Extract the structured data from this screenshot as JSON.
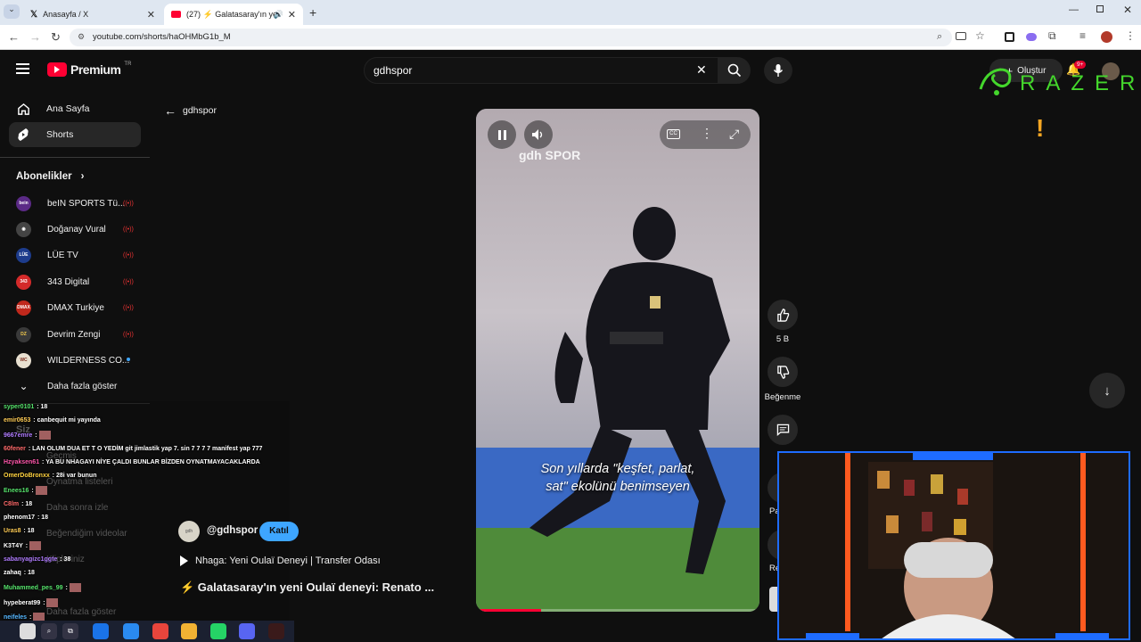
{
  "browser": {
    "tabs": [
      {
        "title": "Anasayfa / X",
        "icon": "x-logo-icon"
      },
      {
        "title": "(27) ⚡ Galatasaray'ın yeni",
        "icon": "youtube-icon",
        "active": true
      }
    ],
    "url": "youtube.com/shorts/haOHMbG1b_M"
  },
  "header": {
    "logo": "Premium",
    "region": "TR",
    "search_value": "gdhspor",
    "create_label": "Oluştur",
    "notifications_badge": "9+"
  },
  "sidebar": {
    "items": [
      {
        "label": "Ana Sayfa",
        "icon": "home-icon"
      },
      {
        "label": "Shorts",
        "icon": "shorts-icon"
      }
    ],
    "subscriptions_label": "Abonelikler",
    "subscriptions": [
      {
        "name": "beIN SPORTS Tü...",
        "avatar_color": "#5b2a86"
      },
      {
        "name": "Doğanay Vural",
        "avatar_color": "#444444"
      },
      {
        "name": "LÜE TV",
        "avatar_color": "#1d3c8c"
      },
      {
        "name": "343 Digital",
        "avatar_color": "#d42a2a"
      },
      {
        "name": "DMAX Turkiye",
        "avatar_color": "#c0281c"
      },
      {
        "name": "Devrim Zengi",
        "avatar_color": "#3a3a3a"
      },
      {
        "name": "WILDERNESS CO...",
        "avatar_color": "#e8e0d0"
      }
    ],
    "show_more_label": "Daha fazla göster",
    "you_items": [
      "Siz",
      "Geçmiş",
      "Oynatma listeleri",
      "Daha sonra izle",
      "Beğendiğim videolar",
      "Klipleriniz",
      "Daha fazla göster"
    ]
  },
  "back": {
    "label": "gdhspor"
  },
  "chat": [
    {
      "user": "syper0101",
      "msg": "18",
      "color": "#55e36b"
    },
    {
      "user": "emir0653",
      "msg": "canbequit mi yayında",
      "color": "#ffcc55"
    },
    {
      "user": "9667emre",
      "msg": "",
      "color": "#b07cff"
    },
    {
      "user": "60fener",
      "msg": "LAN OLUM DUA ET T O YEDİM git jimlastik yap 7. sin 7 7 7 7 manifest yap 777",
      "color": "#ff6a6a"
    },
    {
      "user": "Hzyaksen61",
      "msg": "YA BU NHAGAYI NİYE ÇALDI BUNLAR BİZDEN OYNATMAYACAKLARDA",
      "color": "#ff55aa"
    },
    {
      "user": "OmerDoBronxx",
      "msg": "28i var bunun",
      "color": "#ffd23f"
    },
    {
      "user": "Enees16",
      "msg": "",
      "color": "#55e36b"
    },
    {
      "user": "C8lm",
      "msg": "18",
      "color": "#ff6a6a"
    },
    {
      "user": "phenom17",
      "msg": "18",
      "color": "#ffffff"
    },
    {
      "user": "Uras8",
      "msg": "18",
      "color": "#ffcc55"
    },
    {
      "user": "K3T4Y",
      "msg": "",
      "color": "#ffffff"
    },
    {
      "user": "sabanyagizc1ggte",
      "msg": "38",
      "color": "#b07cff"
    },
    {
      "user": "zahaq",
      "msg": "18",
      "color": "#ffffff"
    },
    {
      "user": "Muhammed_pes_99",
      "msg": "",
      "color": "#55e36b"
    },
    {
      "user": "hypeberat99",
      "msg": "",
      "color": "#ffffff"
    },
    {
      "user": "neifeles",
      "msg": "",
      "color": "#55b7ff"
    },
    {
      "user": "edarkiss",
      "msg": "",
      "color": "#b07cff"
    }
  ],
  "video": {
    "watermark": "gdh SPOR",
    "caption_lines": [
      "Son yıllarda \"keşfet, parlat,",
      "sat\" ekolünü benimseyen"
    ],
    "progress": 0.23
  },
  "meta": {
    "channel": "@gdhspor",
    "join_label": "Katıl",
    "playlist": "Nhaga: Yeni Oulaï Deneyi | Transfer Odası",
    "title": "⚡ Galatasaray'ın yeni Oulaï deneyi: Renato ..."
  },
  "actions": {
    "likes": "5 B",
    "dislike_label": "Beğenme",
    "share_label_partial": "Pa",
    "remix_label_partial": "Re"
  },
  "overlay": {
    "brand_text": "RAZER",
    "alert_glyph": "!"
  },
  "colors": {
    "youtube_red": "#ff0033",
    "join_blue": "#3ea6ff",
    "razer_green": "#44d62c",
    "cam_border": "#1e6cff"
  }
}
